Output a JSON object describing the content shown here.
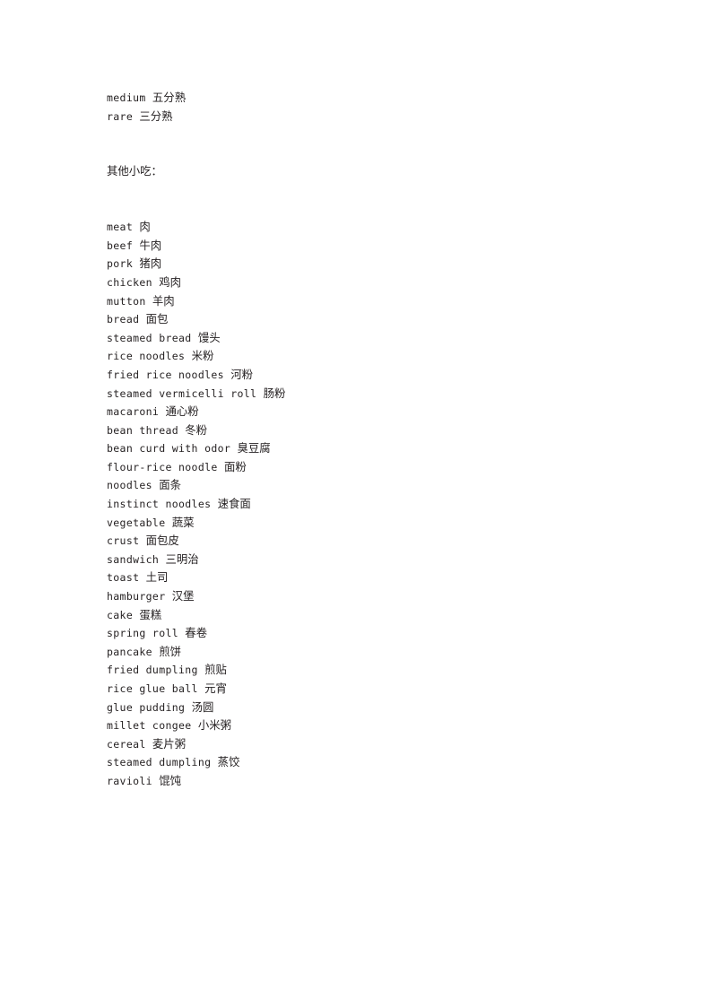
{
  "document": {
    "page_background": "#ffffff",
    "text_color": "#231f20"
  },
  "top_entries": [
    {
      "en": "medium ",
      "cn": "五分熟"
    },
    {
      "en": "rare ",
      "cn": "三分熟"
    }
  ],
  "section": {
    "heading": "其他小吃："
  },
  "entries": [
    {
      "en": "meat ",
      "cn": "肉"
    },
    {
      "en": "beef ",
      "cn": "牛肉"
    },
    {
      "en": "pork ",
      "cn": "猪肉"
    },
    {
      "en": "chicken ",
      "cn": "鸡肉"
    },
    {
      "en": "mutton ",
      "cn": "羊肉"
    },
    {
      "en": "bread ",
      "cn": "面包"
    },
    {
      "en": "steamed bread ",
      "cn": "馒头"
    },
    {
      "en": "rice noodles ",
      "cn": "米粉"
    },
    {
      "en": "fried rice noodles ",
      "cn": "河粉"
    },
    {
      "en": "steamed vermicelli roll ",
      "cn": "肠粉"
    },
    {
      "en": "macaroni ",
      "cn": "通心粉"
    },
    {
      "en": "bean thread ",
      "cn": "冬粉"
    },
    {
      "en": "bean curd with odor ",
      "cn": "臭豆腐"
    },
    {
      "en": "flour-rice noodle ",
      "cn": "面粉"
    },
    {
      "en": "noodles ",
      "cn": "面条"
    },
    {
      "en": "instinct noodles ",
      "cn": "速食面"
    },
    {
      "en": "vegetable ",
      "cn": "蔬菜"
    },
    {
      "en": "crust ",
      "cn": "面包皮"
    },
    {
      "en": "sandwich ",
      "cn": "三明治"
    },
    {
      "en": "toast ",
      "cn": "土司"
    },
    {
      "en": "hamburger ",
      "cn": "汉堡"
    },
    {
      "en": "cake ",
      "cn": "蛋糕"
    },
    {
      "en": "spring roll ",
      "cn": "春卷"
    },
    {
      "en": "pancake ",
      "cn": "煎饼"
    },
    {
      "en": "fried dumpling ",
      "cn": "煎贴"
    },
    {
      "en": "rice glue ball ",
      "cn": "元宵"
    },
    {
      "en": "glue pudding ",
      "cn": "汤圆"
    },
    {
      "en": "millet congee ",
      "cn": "小米粥"
    },
    {
      "en": "cereal ",
      "cn": "麦片粥"
    },
    {
      "en": "steamed dumpling ",
      "cn": "蒸饺"
    },
    {
      "en": "ravioli ",
      "cn": "馄饨"
    }
  ]
}
